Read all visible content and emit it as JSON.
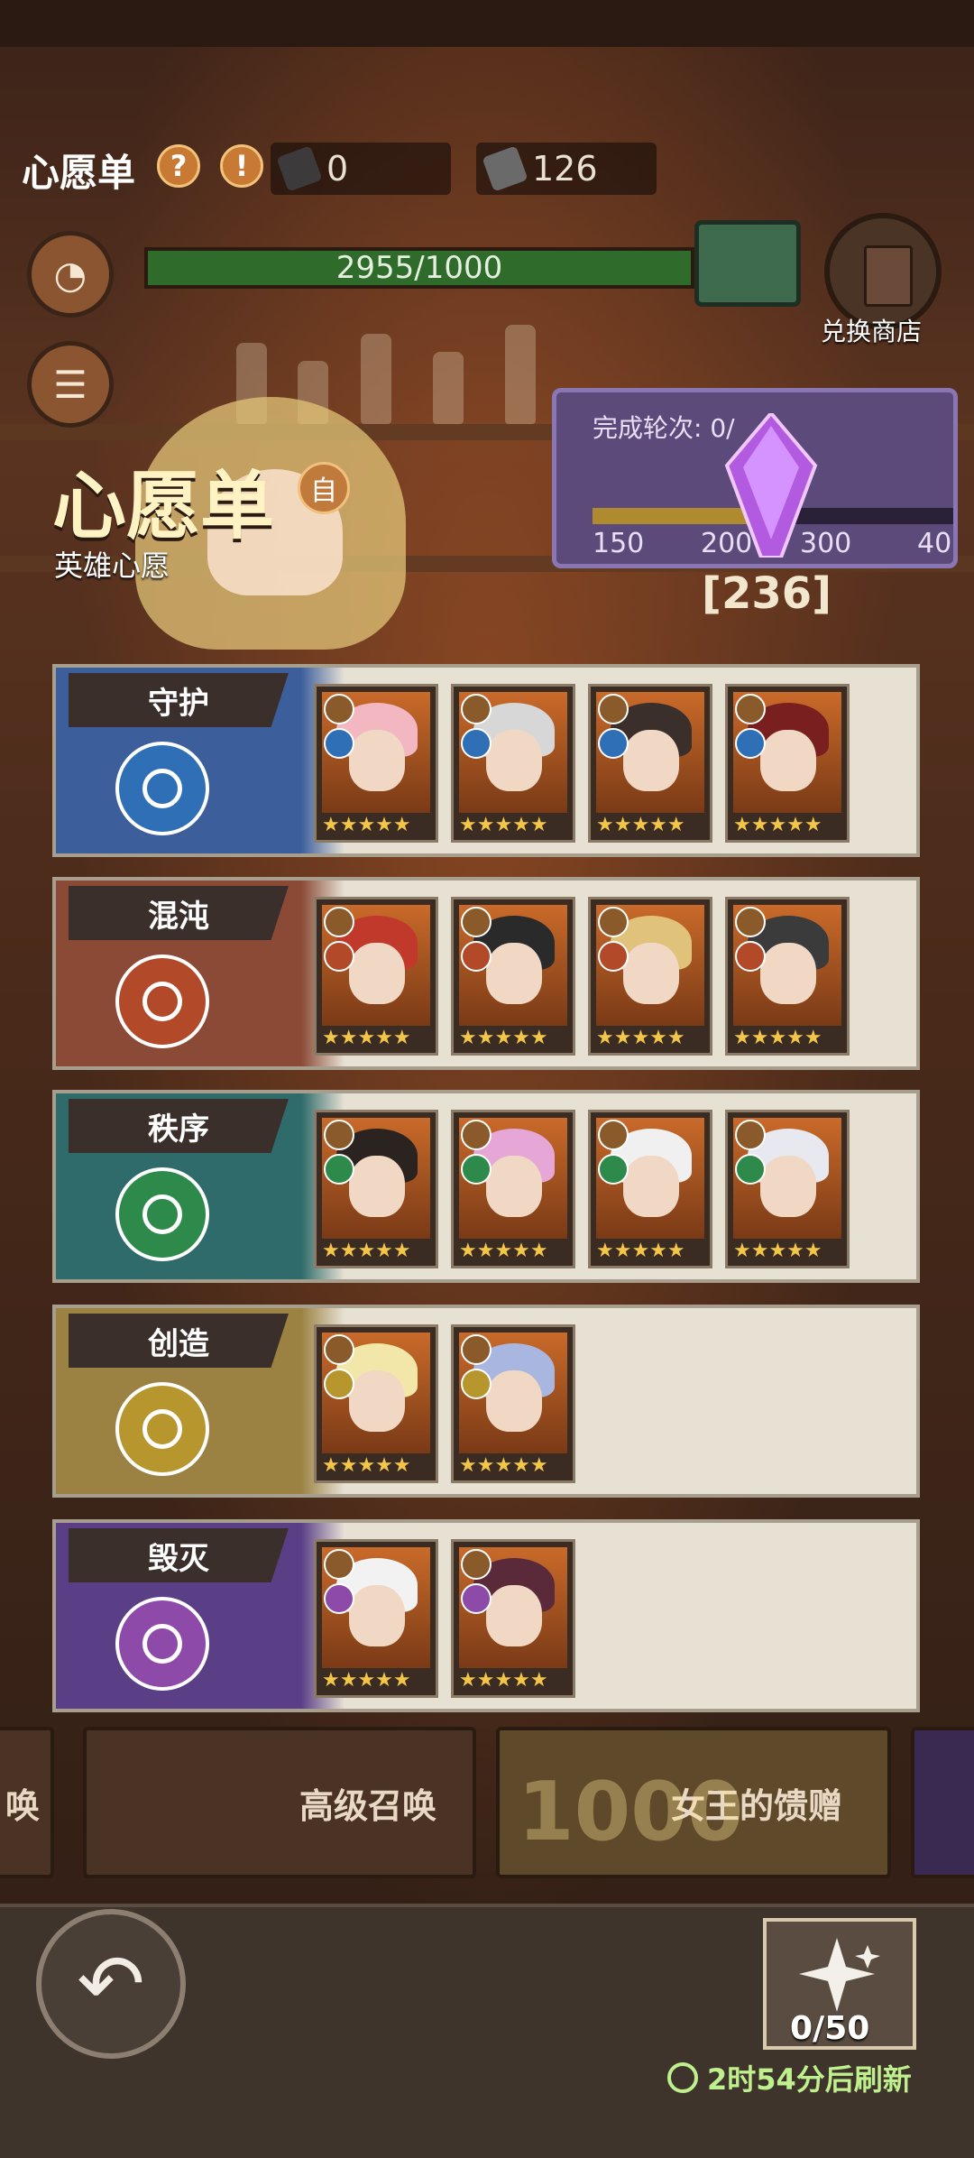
{
  "header": {
    "title": "心愿单",
    "help_icon": "?",
    "alert_icon": "!",
    "resource_1_value": "0",
    "resource_2_value": "126"
  },
  "progress": {
    "text": "2955/1000",
    "fill_fraction": 1.0
  },
  "shop": {
    "label": "兑换商店"
  },
  "round_panel": {
    "label": "完成轮次: 0/",
    "marks": [
      "150",
      "200",
      "300",
      "40"
    ],
    "crystal_count": "[236]"
  },
  "wish": {
    "title": "心愿单",
    "subtitle": "英雄心愿",
    "badge_icon": "自"
  },
  "factions": [
    {
      "name": "守护",
      "accent": "#3c5f9c",
      "emblem_color": "#2f6fb6",
      "hero_count": 4,
      "stars": "★★★★★"
    },
    {
      "name": "混沌",
      "accent": "#8a4a36",
      "emblem_color": "#b24a2a",
      "hero_count": 4,
      "stars": "★★★★★"
    },
    {
      "name": "秩序",
      "accent": "#2e6b6a",
      "emblem_color": "#2d8a4a",
      "hero_count": 4,
      "stars": "★★★★★"
    },
    {
      "name": "创造",
      "accent": "#9c8242",
      "emblem_color": "#b8962e",
      "hero_count": 2,
      "stars": "★★★★★"
    },
    {
      "name": "毁灭",
      "accent": "#5a3f86",
      "emblem_color": "#8e4aa8",
      "hero_count": 2,
      "stars": "★★★★★"
    }
  ],
  "bottom_cards": {
    "left_fragment": "唤",
    "advanced_summon": "高级召唤",
    "queen_gift": "女王的馈赠",
    "queen_gift_number": "1000"
  },
  "footer": {
    "wish_count": "0/50",
    "refresh_text": "2时54分后刷新",
    "back_icon": "↶"
  }
}
